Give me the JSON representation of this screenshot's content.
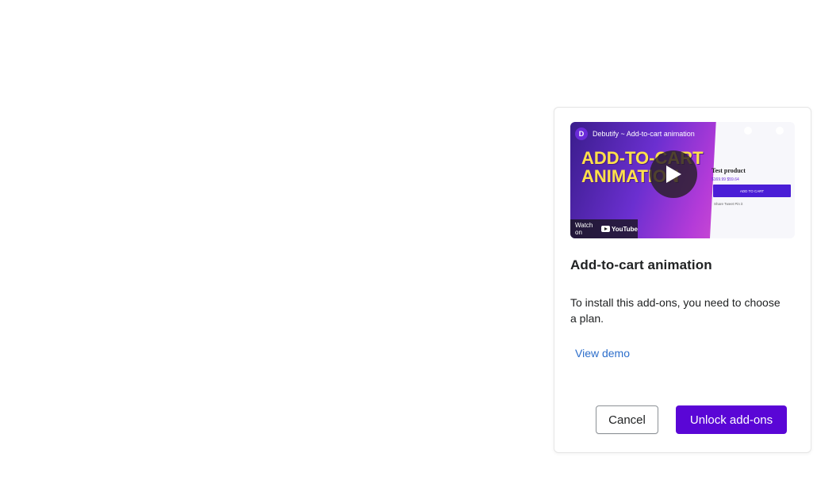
{
  "dialog": {
    "video": {
      "channel_logo": "D",
      "channel_title": "Debutify ~ Add-to-cart animation",
      "headline": "ADD-TO-CART ANIMATION",
      "watch_on": "Watch on",
      "youtube_label": "YouTube",
      "product_title": "Test product",
      "product_price": "$169.99 $59.64",
      "add_to_cart": "ADD TO CART",
      "share_row": "Share  Tweet  Pin it"
    },
    "title": "Add-to-cart animation",
    "description": "To install this add-ons, you need to choose a plan.",
    "view_demo": "View demo",
    "cancel_label": "Cancel",
    "unlock_label": "Unlock add-ons"
  },
  "colors": {
    "primary": "#5a06d6",
    "link": "#2c6ecb",
    "text": "#202223"
  }
}
